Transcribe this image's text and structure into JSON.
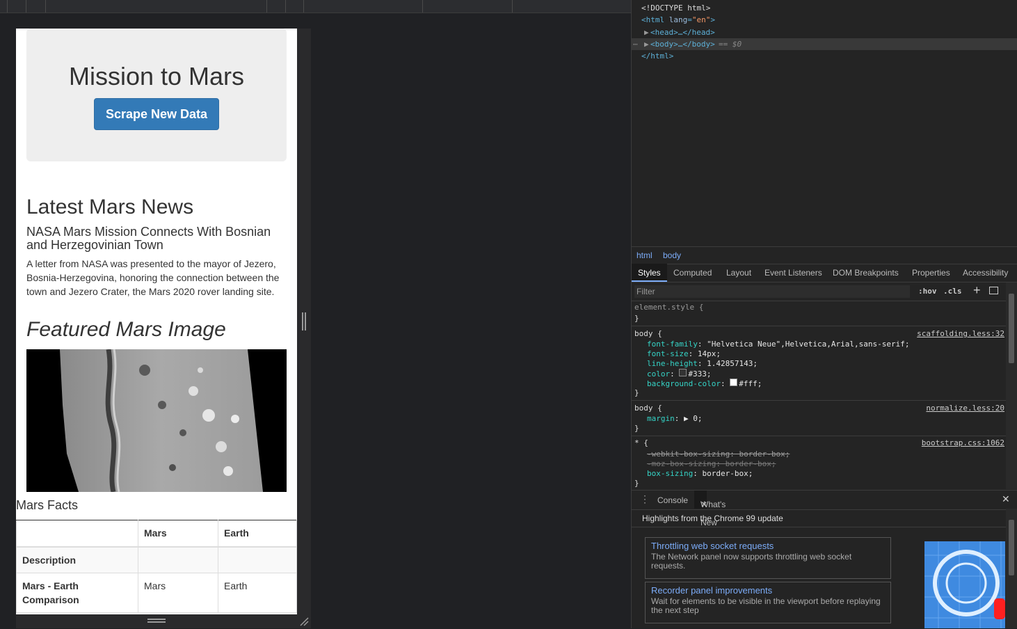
{
  "page": {
    "jumbotron_title": "Mission to Mars",
    "scrape_button": "Scrape New Data",
    "news_heading": "Latest Mars News",
    "news_title": "NASA Mars Mission Connects With Bosnian and Herzegovinian Town",
    "news_paragraph": "A letter from NASA was presented to the mayor of Jezero, Bosnia-Herzegovina, honoring the connection between the town and Jezero Crater, the Mars 2020 rover landing site.",
    "featured_heading": "Featured Mars Image",
    "facts_heading": "Mars Facts",
    "facts_table": {
      "header": [
        "",
        "Mars",
        "Earth"
      ],
      "rows": [
        [
          "Description",
          "",
          ""
        ],
        [
          "Mars - Earth Comparison",
          "Mars",
          "Earth"
        ]
      ]
    }
  },
  "devtools": {
    "dom": {
      "doctype": "<!DOCTYPE html>",
      "html_open_tag": "<html",
      "html_attr": "lang",
      "html_attr_val": "\"en\"",
      "head": "<head>…</head>",
      "body": "<body>…</body>",
      "selected_marker": "== $0",
      "html_close": "</html>",
      "dots": "⋯"
    },
    "breadcrumbs": [
      "html",
      "body"
    ],
    "tabs": [
      "Styles",
      "Computed",
      "Layout",
      "Event Listeners",
      "DOM Breakpoints",
      "Properties",
      "Accessibility"
    ],
    "filter_placeholder": "Filter",
    "filter_hov": ":hov",
    "filter_cls": ".cls",
    "styles": {
      "element_style": "element.style {",
      "close": "}",
      "rule1_selector": "body {",
      "rule1_source": "scaffolding.less:32",
      "rule1_props": [
        {
          "p": "font-family",
          "v": "\"Helvetica Neue\",Helvetica,Arial,sans-serif;"
        },
        {
          "p": "font-size",
          "v": "14px;"
        },
        {
          "p": "line-height",
          "v": "1.42857143;"
        },
        {
          "p": "color",
          "v": "#333;"
        },
        {
          "p": "background-color",
          "v": "#fff;"
        }
      ],
      "rule2_selector": "body {",
      "rule2_source": "normalize.less:20",
      "rule2_prop": "margin",
      "rule2_val": "▶ 0;",
      "rule3_selector": "* {",
      "rule3_source": "bootstrap.css:1062",
      "rule3_props": [
        {
          "p": "-webkit-box-sizing",
          "v": "border-box;"
        },
        {
          "p": "-moz-box-sizing",
          "v": "border-box;"
        },
        {
          "p": "box-sizing",
          "v": "border-box;"
        }
      ]
    },
    "drawer_tabs": [
      "Console",
      "What's New"
    ],
    "whats_new_heading": "Highlights from the Chrome 99 update",
    "cards": [
      {
        "title": "Throttling web socket requests",
        "desc": "The Network panel now supports throttling web socket requests."
      },
      {
        "title": "Recorder panel improvements",
        "desc": "Wait for elements to be visible in the viewport before replaying the next step"
      }
    ],
    "colors": {
      "swatch_333": "#333333",
      "swatch_fff": "#ffffff",
      "link": "#7cacf8"
    }
  }
}
